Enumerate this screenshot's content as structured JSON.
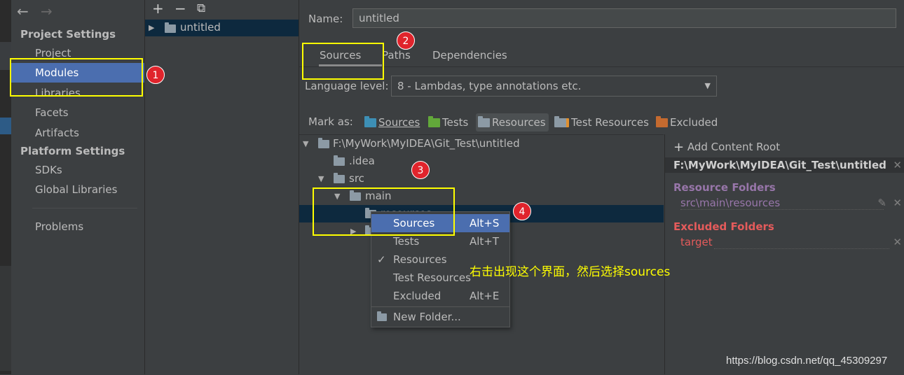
{
  "nav": {
    "back": "←",
    "forward": "→",
    "project_settings": "Project Settings",
    "items_project": [
      "Project",
      "Modules",
      "Libraries",
      "Facets",
      "Artifacts"
    ],
    "platform_settings": "Platform Settings",
    "items_platform": [
      "SDKs",
      "Global Libraries"
    ],
    "problems": "Problems",
    "selected": "Modules"
  },
  "modules": {
    "toolbar": [
      "+",
      "−",
      "⧉"
    ],
    "item": "untitled"
  },
  "detail": {
    "name_label": "Name:",
    "name_value": "untitled",
    "tabs": [
      "Sources",
      "Paths",
      "Dependencies"
    ],
    "active_tab": "Sources",
    "language_label": "Language level:",
    "language_value": "8 - Lambdas, type annotations etc.",
    "mark_as_label": "Mark as:",
    "mark_as": [
      {
        "label": "Sources",
        "color": "#3d8fb5"
      },
      {
        "label": "Tests",
        "color": "#62a83a"
      },
      {
        "label": "Resources",
        "color": "#8c9aa5"
      },
      {
        "label": "Test Resources",
        "color": "#8c9aa5"
      },
      {
        "label": "Excluded",
        "color": "#c46a2f"
      }
    ]
  },
  "tree": {
    "root": "F:\\MyWork\\MyIDEA\\Git_Test\\untitled",
    "idea": ".idea",
    "src": "src",
    "main": "main",
    "resources": "resources"
  },
  "root_pane": {
    "add_content_root": "Add Content Root",
    "root_path": "F:\\MyWork\\MyIDEA\\Git_Test\\untitled",
    "resource_folders_title": "Resource Folders",
    "resource_folder": "src\\main\\resources",
    "excluded_folders_title": "Excluded Folders",
    "excluded_folder": "target",
    "colors": {
      "resource": "#9876aa",
      "excluded": "#e55b5b"
    }
  },
  "context_menu": {
    "items": [
      {
        "label": "Sources",
        "shortcut": "Alt+S"
      },
      {
        "label": "Tests",
        "shortcut": "Alt+T"
      },
      {
        "label": "Resources",
        "shortcut": ""
      },
      {
        "label": "Test Resources",
        "shortcut": ""
      },
      {
        "label": "Excluded",
        "shortcut": "Alt+E"
      },
      {
        "label": "New Folder...",
        "shortcut": ""
      }
    ],
    "checked": "Resources",
    "highlighted": "Sources"
  },
  "annotations": {
    "badges": [
      "1",
      "2",
      "3",
      "4"
    ],
    "note": "右击出现这个界面，然后选择sources",
    "highlight_color": "#ffff00"
  },
  "watermark": "https://blog.csdn.net/qq_45309297"
}
